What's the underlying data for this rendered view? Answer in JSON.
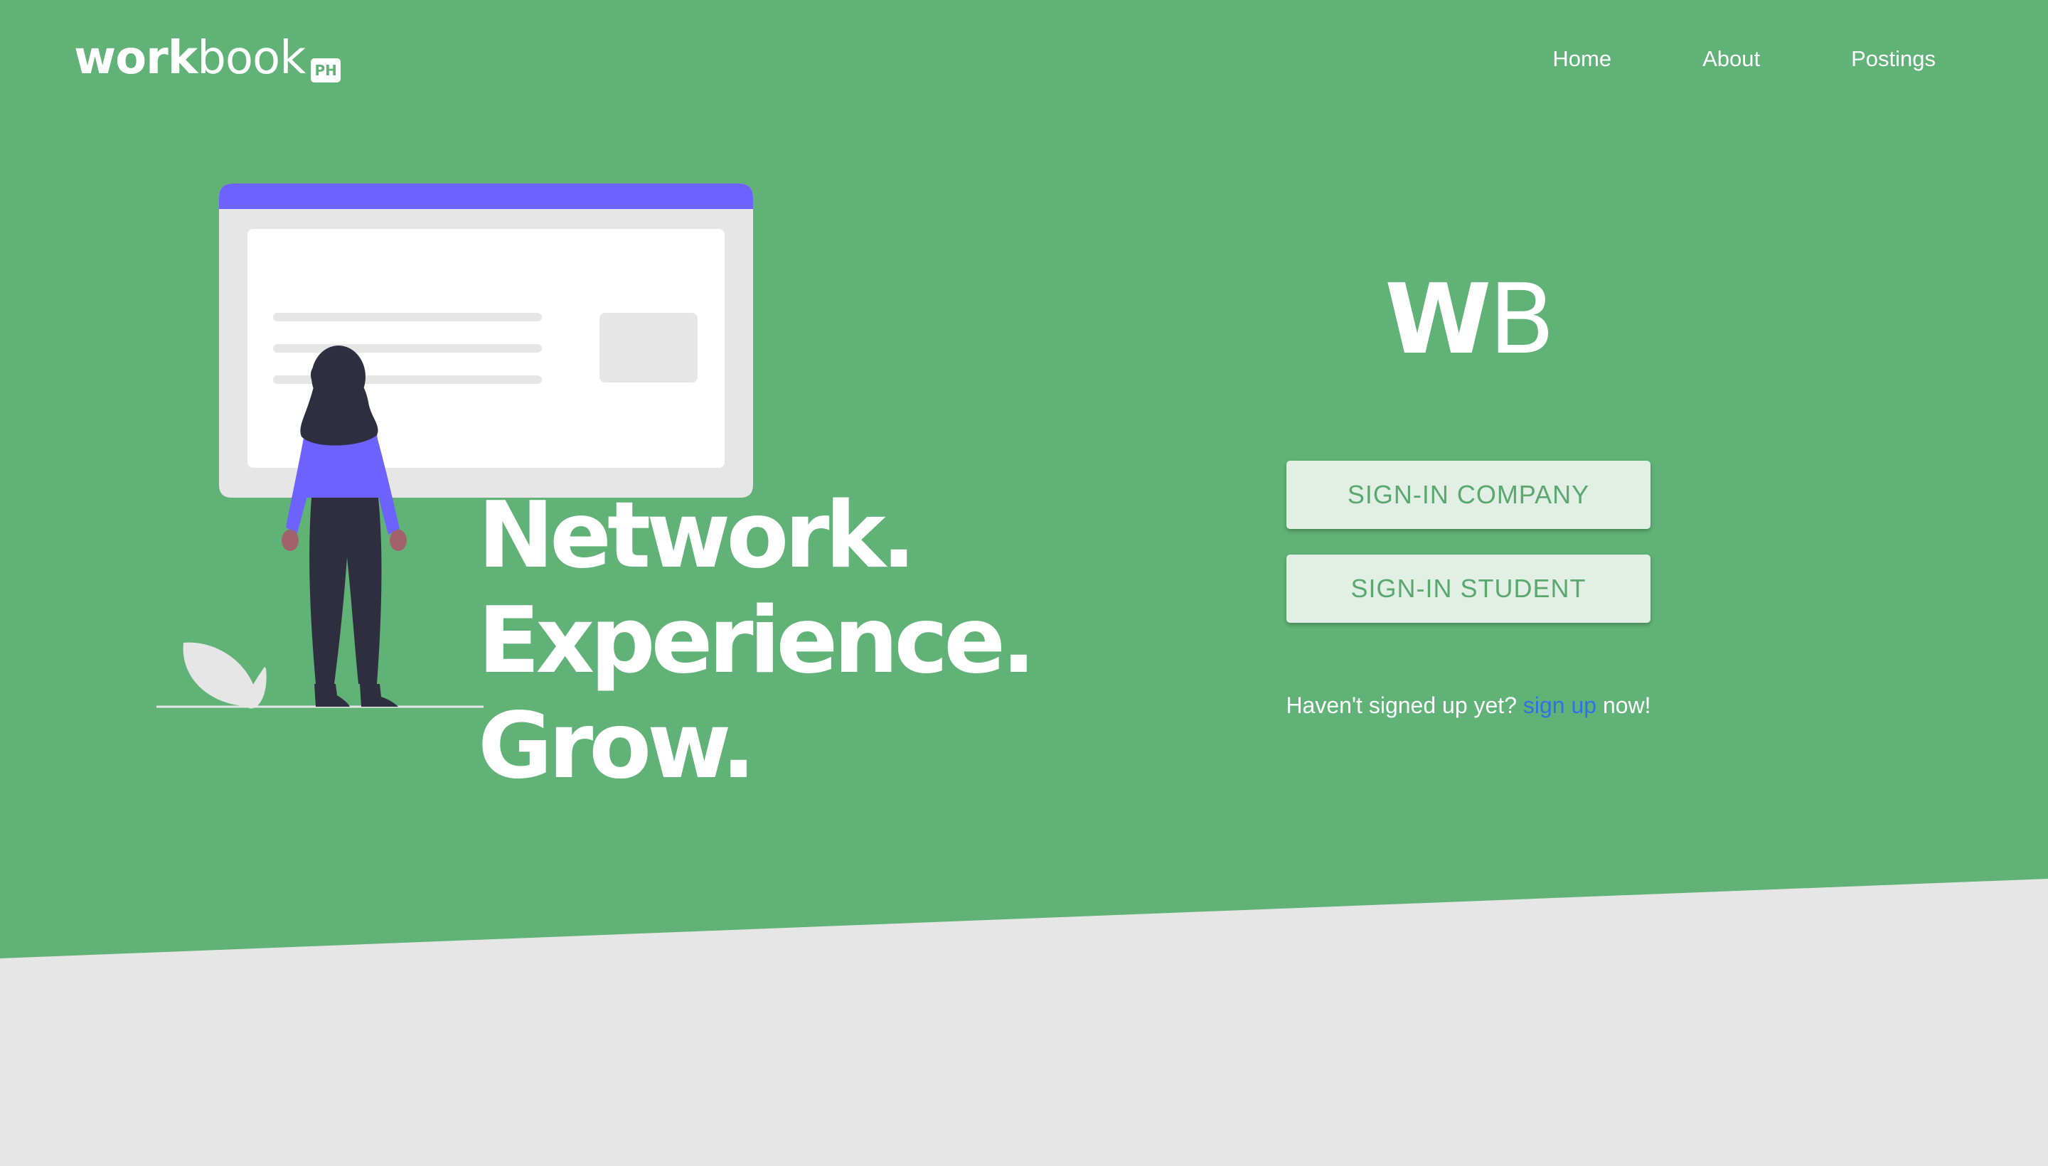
{
  "colors": {
    "hero_green": "#60b276",
    "footer_gray": "#e6e6e6",
    "button_bg": "#e1efe4",
    "button_text": "#5aa86f",
    "link_blue": "#2f72e6",
    "accent_purple": "#6c63ff"
  },
  "nav": {
    "brand_bold": "work",
    "brand_regular": "book",
    "brand_badge": "PH",
    "links": [
      "Home",
      "About",
      "Postings"
    ]
  },
  "hero": {
    "tagline": [
      "Network.",
      "Experience.",
      "Grow."
    ],
    "illustration": "person-viewing-browser-window"
  },
  "auth": {
    "logo_bold": "W",
    "logo_regular": "B",
    "signin_company": "SIGN-IN COMPANY",
    "signin_student": "SIGN-IN STUDENT",
    "signup_prefix": "Haven't signed up yet?",
    "signup_link": "sign up",
    "signup_suffix": "now!"
  }
}
